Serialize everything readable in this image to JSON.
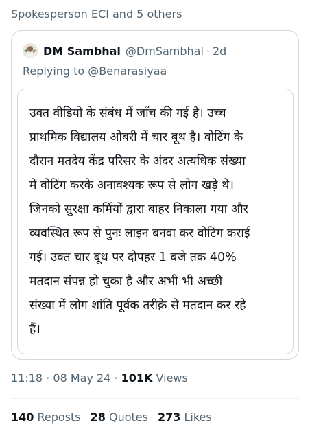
{
  "social_context": "Spokesperson ECI and 5 others",
  "quote": {
    "author_name": "DM Sambhal",
    "author_handle": "@DmSambhal",
    "separator": "·",
    "time": "2d",
    "replying_prefix": "Replying to ",
    "replying_to": "@Benarasiyaa",
    "body_lines": [
      "उक्त वीडियो के संबंध में जाँच की गई है। उच्च",
      "प्राथमिक विद्यालय ओबरी में चार बूथ है। वोटिंग के",
      "दौरान मतदेय केंद्र  परिसर के अंदर अत्यधिक संख्या",
      "में वोटिंग करके अनावश्यक रूप से लोग खड़े थे।",
      "जिनको सुरक्षा कर्मियों द्वारा बाहर निकाला गया और",
      "व्यवस्थित रूप से पुनः लाइन बनवा कर वोटिंग कराई",
      "गई। उक्त चार बूथ पर दोपहर 1 बजे तक 40%",
      "मतदान संपन्न हो चुका  है और  अभी भी अच्छी",
      "संख्या में लोग शांति पूर्वक तरीक़े से मतदान कर रहे",
      "हैं।"
    ]
  },
  "meta": {
    "time": "11:18",
    "separator": "·",
    "date": "08 May 24",
    "views_count": "101K",
    "views_label": "Views"
  },
  "stats": {
    "reposts_count": "140",
    "reposts_label": "Reposts",
    "quotes_count": "28",
    "quotes_label": "Quotes",
    "likes_count": "273",
    "likes_label": "Likes"
  }
}
